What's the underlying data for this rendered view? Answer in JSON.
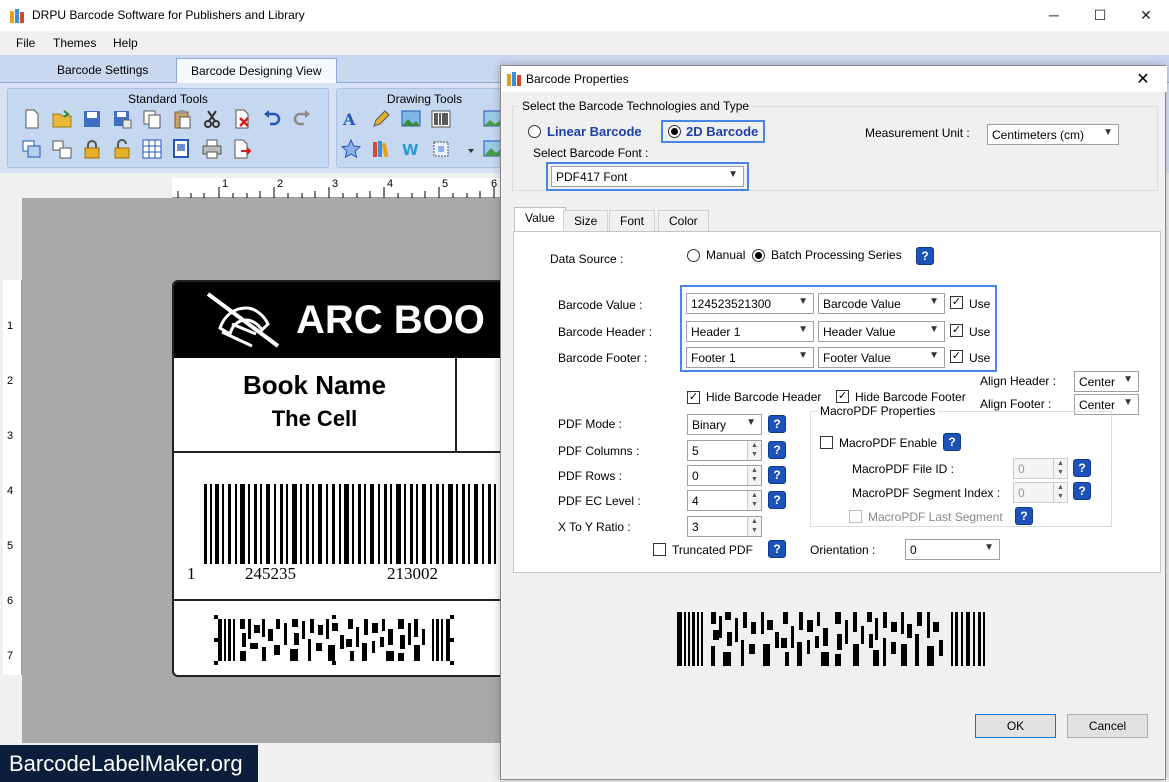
{
  "window": {
    "title": "DRPU Barcode Software for Publishers and Library",
    "controls": {
      "minimize": "─",
      "maximize": "☐",
      "close": "✕"
    }
  },
  "menu": [
    "File",
    "Themes",
    "Help"
  ],
  "main_tabs": [
    {
      "label": "Barcode Settings",
      "active": false
    },
    {
      "label": "Barcode Designing View",
      "active": true
    }
  ],
  "ribbon": {
    "standard_tools": "Standard Tools",
    "drawing_tools": "Drawing Tools"
  },
  "rulers": {
    "horizontal": [
      "1",
      "2",
      "3",
      "4",
      "5",
      "6"
    ],
    "vertical": [
      "1",
      "2",
      "3",
      "4",
      "5",
      "6",
      "7"
    ]
  },
  "label": {
    "brand": "ARC BOO",
    "book_name": "Book Name",
    "book_title": "The Cell",
    "barcode_numbers": [
      "1",
      "245235",
      "213002"
    ]
  },
  "watermark": "BarcodeLabelMaker.org",
  "dialog": {
    "title": "Barcode Properties",
    "close": "✕",
    "technologies": {
      "legend": "Select the Barcode Technologies and Type",
      "linear": "Linear Barcode",
      "twod": "2D Barcode",
      "selected": "2D Barcode",
      "measurement_label": "Measurement Unit :",
      "measurement_value": "Centimeters (cm)",
      "font_label": "Select Barcode Font :",
      "font_value": "PDF417 Font"
    },
    "tabs": [
      "Value",
      "Size",
      "Font",
      "Color"
    ],
    "value_tab": {
      "data_source_label": "Data Source :",
      "manual": "Manual",
      "batch": "Batch Processing Series",
      "rows": [
        {
          "label": "Barcode Value :",
          "field": "124523521300",
          "source": "Barcode Value",
          "use": "Use"
        },
        {
          "label": "Barcode Header :",
          "field": "Header 1",
          "source": "Header Value",
          "use": "Use"
        },
        {
          "label": "Barcode Footer :",
          "field": "Footer 1",
          "source": "Footer Value",
          "use": "Use"
        }
      ],
      "hide_header": "Hide Barcode Header",
      "hide_footer": "Hide Barcode Footer",
      "align_header_label": "Align Header :",
      "align_header_value": "Center",
      "align_footer_label": "Align Footer :",
      "align_footer_value": "Center",
      "pdf_mode_label": "PDF Mode :",
      "pdf_mode_value": "Binary",
      "pdf_columns_label": "PDF Columns :",
      "pdf_columns_value": "5",
      "pdf_rows_label": "PDF Rows :",
      "pdf_rows_value": "0",
      "pdf_ec_label": "PDF EC Level :",
      "pdf_ec_value": "4",
      "xy_ratio_label": "X To Y Ratio :",
      "xy_ratio_value": "3",
      "truncated": "Truncated PDF",
      "macro": {
        "legend": "MacroPDF Properties",
        "enable": "MacroPDF Enable",
        "file_id_label": "MacroPDF File ID :",
        "file_id_value": "0",
        "segment_index_label": "MacroPDF Segment Index :",
        "segment_index_value": "0",
        "last_segment": "MacroPDF Last Segment"
      },
      "orientation_label": "Orientation :",
      "orientation_value": "0"
    },
    "ok": "OK",
    "cancel": "Cancel"
  },
  "colors": {
    "accent_blue": "#1f3fa7",
    "highlight": "#4a86e8",
    "help_icon": "#1d52b8",
    "watermark_bg": "#0c1e3c"
  }
}
